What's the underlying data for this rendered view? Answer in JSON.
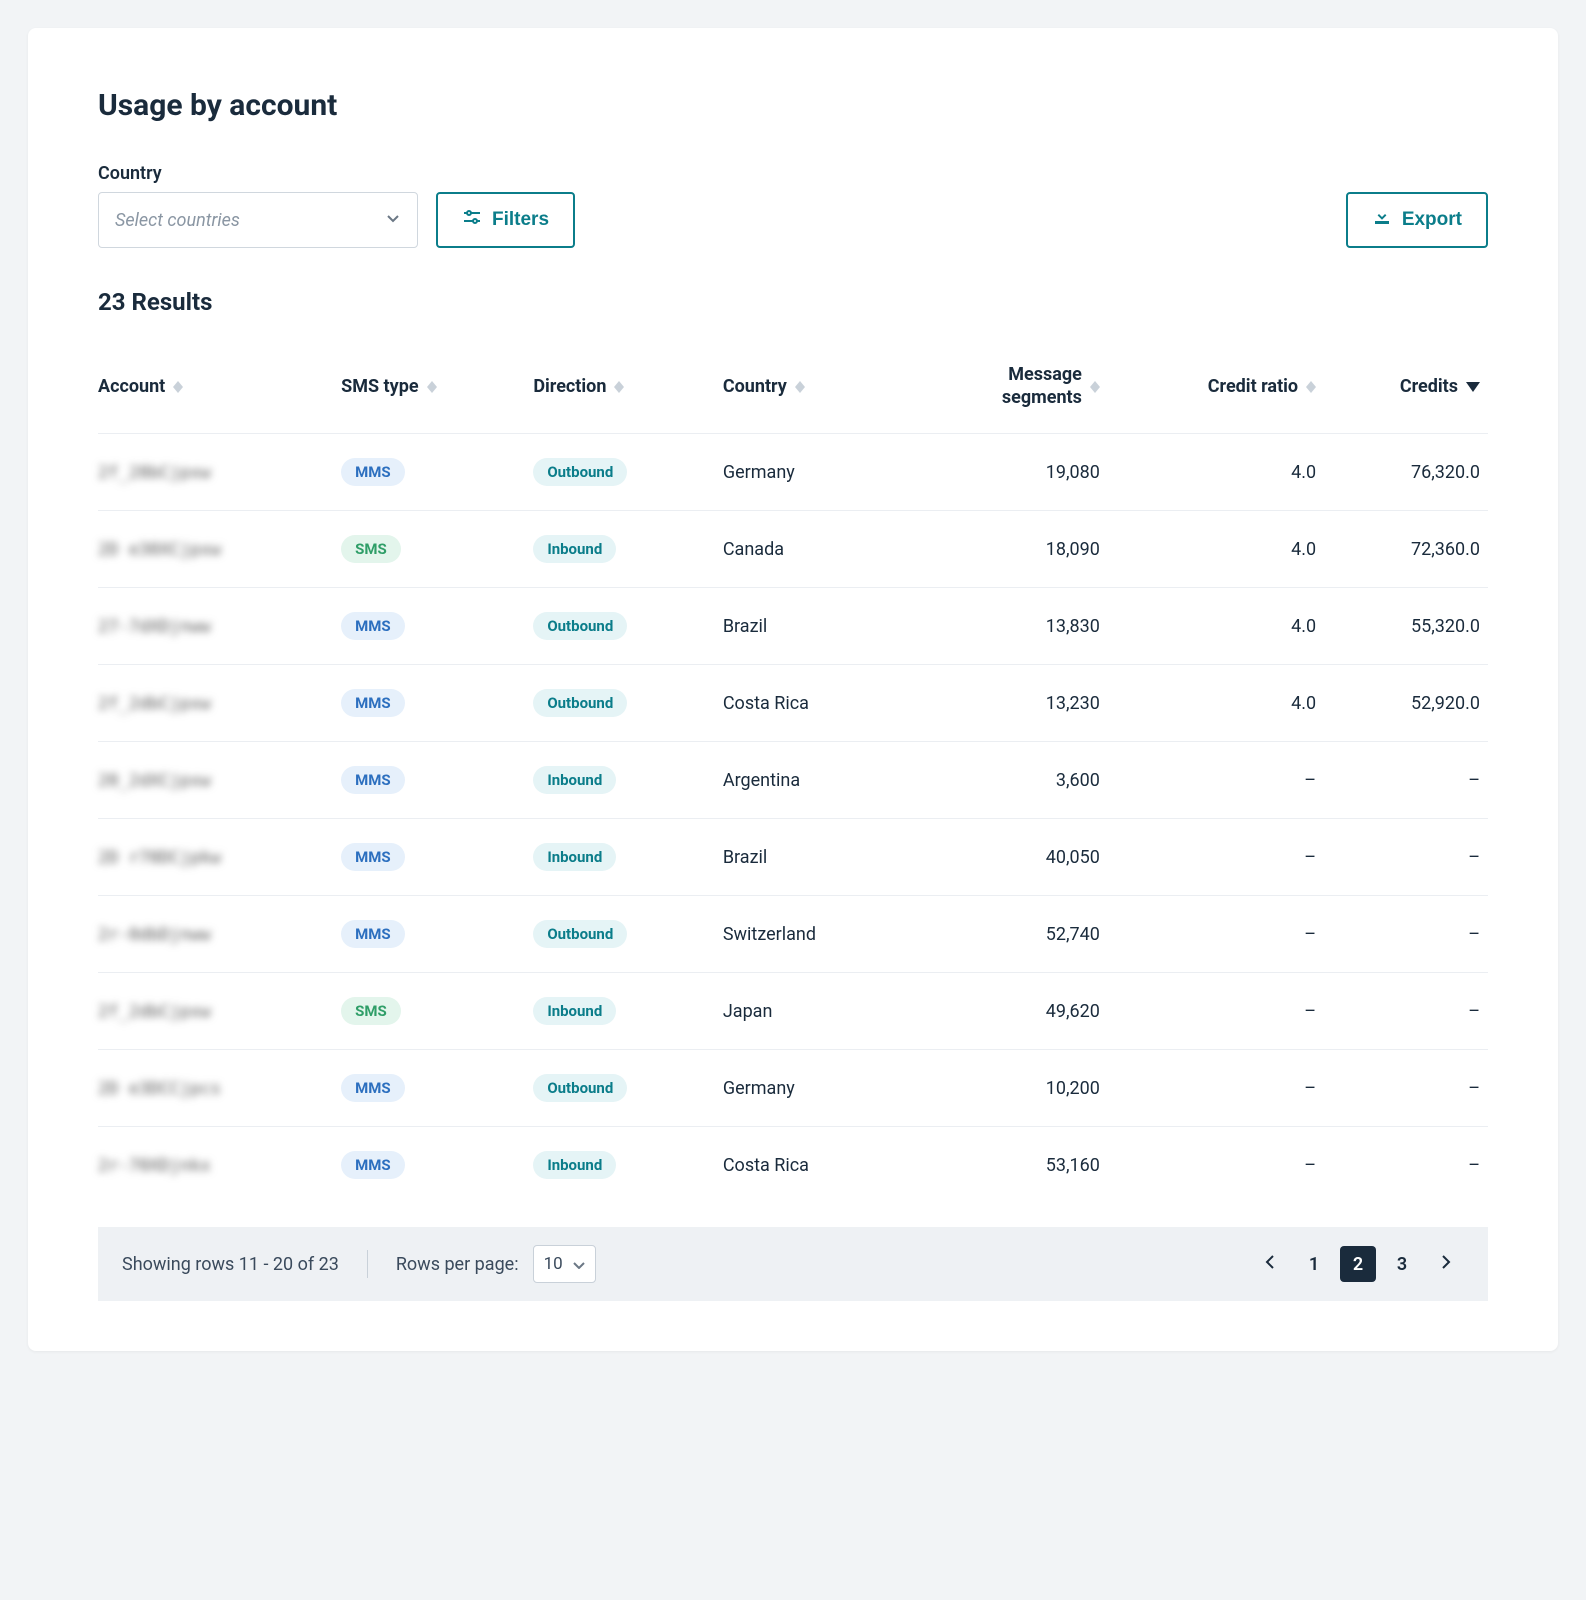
{
  "page": {
    "title": "Usage by account",
    "country_label": "Country",
    "country_placeholder": "Select countries",
    "filters_label": "Filters",
    "export_label": "Export",
    "results_count_text": "23 Results"
  },
  "columns": {
    "account": "Account",
    "sms_type": "SMS type",
    "direction": "Direction",
    "country": "Country",
    "message_segments": "Message\nsegments",
    "credit_ratio": "Credit ratio",
    "credits": "Credits"
  },
  "rows": [
    {
      "account": "2f_28bCjpxw",
      "sms_type": "MMS",
      "direction": "Outbound",
      "country": "Germany",
      "message_segments": "19,080",
      "credit_ratio": "4.0",
      "credits": "76,320.0"
    },
    {
      "account": "2D e30XCjpxw",
      "sms_type": "SMS",
      "direction": "Inbound",
      "country": "Canada",
      "message_segments": "18,090",
      "credit_ratio": "4.0",
      "credits": "72,360.0"
    },
    {
      "account": "27-7dXDjnww",
      "sms_type": "MMS",
      "direction": "Outbound",
      "country": "Brazil",
      "message_segments": "13,830",
      "credit_ratio": "4.0",
      "credits": "55,320.0"
    },
    {
      "account": "2f_2dbCjpxw",
      "sms_type": "MMS",
      "direction": "Outbound",
      "country": "Costa Rica",
      "message_segments": "13,230",
      "credit_ratio": "4.0",
      "credits": "52,920.0"
    },
    {
      "account": "20_2dXCjpxw",
      "sms_type": "MMS",
      "direction": "Inbound",
      "country": "Argentina",
      "message_segments": "3,600",
      "credit_ratio": "–",
      "credits": "–"
    },
    {
      "account": "2D r70DCjpkw",
      "sms_type": "MMS",
      "direction": "Inbound",
      "country": "Brazil",
      "message_segments": "40,050",
      "credit_ratio": "–",
      "credits": "–"
    },
    {
      "account": "2r-0dbDjnww",
      "sms_type": "MMS",
      "direction": "Outbound",
      "country": "Switzerland",
      "message_segments": "52,740",
      "credit_ratio": "–",
      "credits": "–"
    },
    {
      "account": "2f_2dbCjpxw",
      "sms_type": "SMS",
      "direction": "Inbound",
      "country": "Japan",
      "message_segments": "49,620",
      "credit_ratio": "–",
      "credits": "–"
    },
    {
      "account": "2D e3DCCjpcs",
      "sms_type": "MMS",
      "direction": "Outbound",
      "country": "Germany",
      "message_segments": "10,200",
      "credit_ratio": "–",
      "credits": "–"
    },
    {
      "account": "2r-70XDjnkx",
      "sms_type": "MMS",
      "direction": "Inbound",
      "country": "Costa Rica",
      "message_segments": "53,160",
      "credit_ratio": "–",
      "credits": "–"
    }
  ],
  "pagination": {
    "showing_text": "Showing rows 11 - 20 of 23",
    "rows_per_page_label": "Rows per page:",
    "rows_per_page_value": "10",
    "pages": [
      "1",
      "2",
      "3"
    ],
    "current_page": "2"
  }
}
